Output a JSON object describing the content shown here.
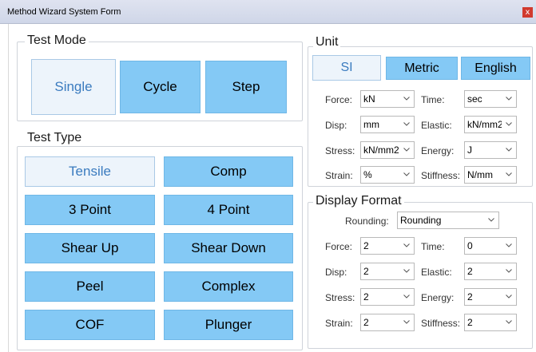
{
  "window": {
    "title": "Method Wizard System Form",
    "close_glyph": "x"
  },
  "test_mode": {
    "legend": "Test Mode",
    "buttons": [
      "Single",
      "Cycle",
      "Step"
    ],
    "selected": "Single"
  },
  "test_type": {
    "legend": "Test Type",
    "buttons": [
      "Tensile",
      "Comp",
      "3 Point",
      "4 Point",
      "Shear Up",
      "Shear Down",
      "Peel",
      "Complex",
      "COF",
      "Plunger"
    ],
    "selected": "Tensile"
  },
  "unit": {
    "legend": "Unit",
    "systems": [
      "SI",
      "Metric",
      "English"
    ],
    "selected": "SI",
    "fields": {
      "force": {
        "label": "Force:",
        "value": "kN"
      },
      "time": {
        "label": "Time:",
        "value": "sec"
      },
      "disp": {
        "label": "Disp:",
        "value": "mm"
      },
      "elastic": {
        "label": "Elastic:",
        "value": "kN/mm2"
      },
      "stress": {
        "label": "Stress:",
        "value": "kN/mm2"
      },
      "energy": {
        "label": "Energy:",
        "value": "J"
      },
      "strain": {
        "label": "Strain:",
        "value": "%"
      },
      "stiffness": {
        "label": "Stiffness:",
        "value": "N/mm"
      }
    }
  },
  "display_format": {
    "legend": "Display Format",
    "rounding": {
      "label": "Rounding:",
      "value": "Rounding"
    },
    "fields": {
      "force": {
        "label": "Force:",
        "value": "2"
      },
      "time": {
        "label": "Time:",
        "value": "0"
      },
      "disp": {
        "label": "Disp:",
        "value": "2"
      },
      "elastic": {
        "label": "Elastic:",
        "value": "2"
      },
      "stress": {
        "label": "Stress:",
        "value": "2"
      },
      "energy": {
        "label": "Energy:",
        "value": "2"
      },
      "strain": {
        "label": "Strain:",
        "value": "2"
      },
      "stiffness": {
        "label": "Stiffness:",
        "value": "2"
      }
    }
  },
  "colors": {
    "button": "#84c9f5",
    "button_selected": "#edf4fb",
    "selected_text": "#3a7bbf"
  }
}
